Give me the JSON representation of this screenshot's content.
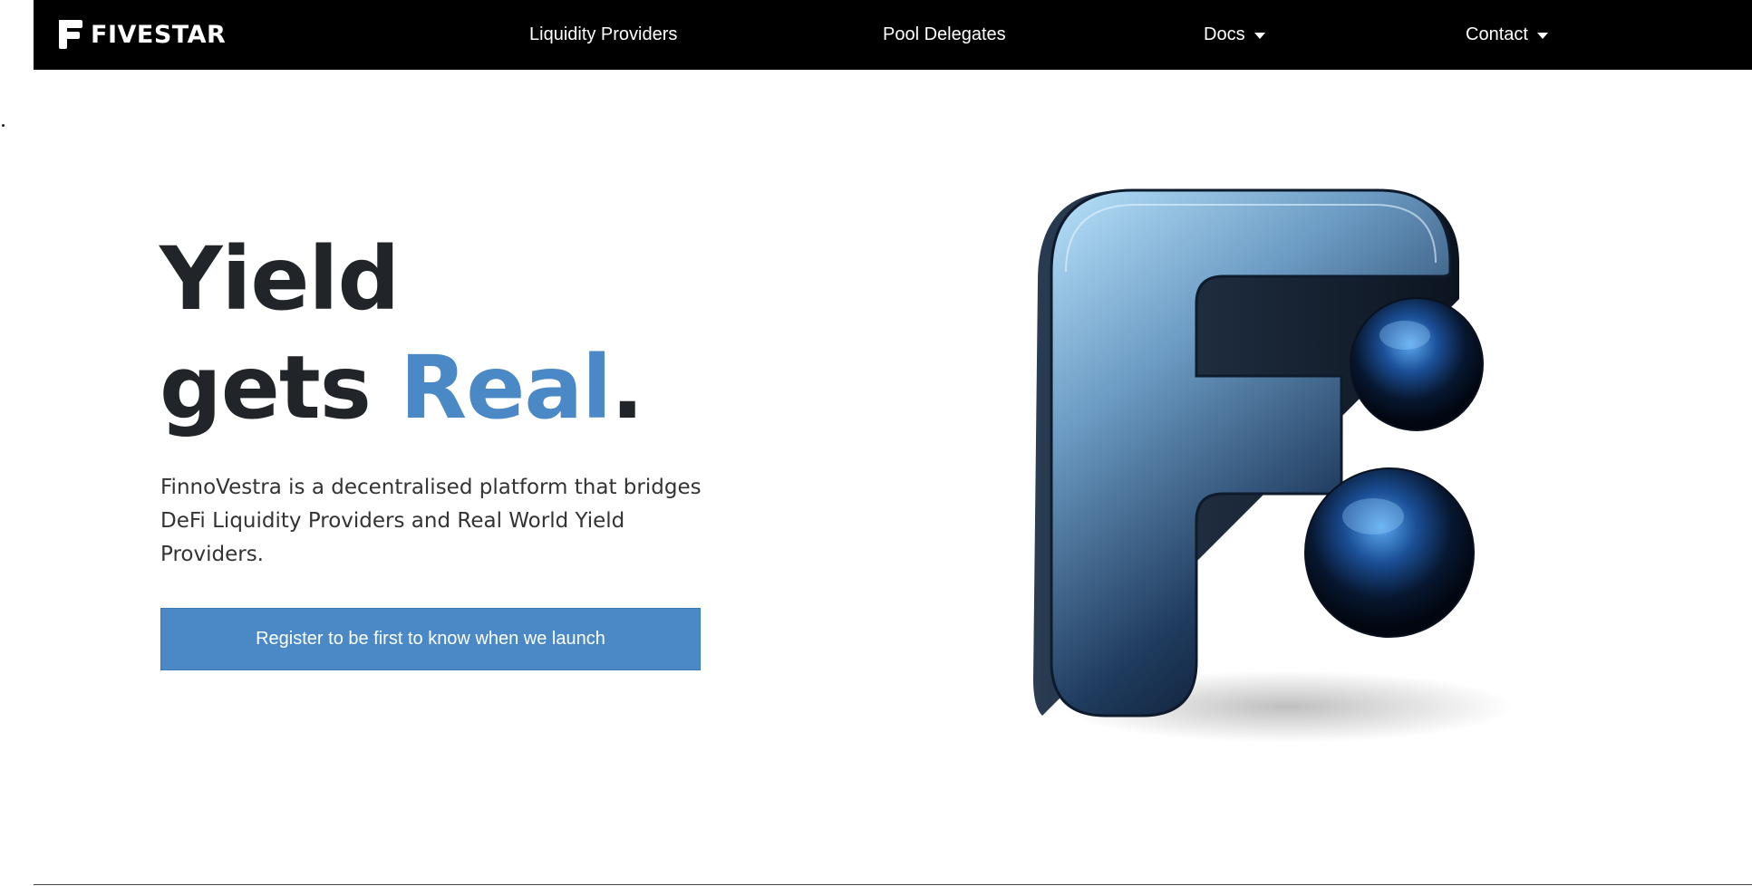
{
  "brand": {
    "name": "FIVESTAR"
  },
  "nav": {
    "items": [
      {
        "label": "Liquidity Providers",
        "dropdown": false
      },
      {
        "label": "Pool Delegates",
        "dropdown": false
      },
      {
        "label": "Docs",
        "dropdown": true
      },
      {
        "label": "Contact",
        "dropdown": true
      }
    ]
  },
  "hero": {
    "title_line1": "Yield",
    "title_line2_word": "gets",
    "title_line2_accent": "Real",
    "title_line2_period": ".",
    "description": "FinnoVestra is a decentralised platform that bridges DeFi Liquidity Providers and Real World Yield Providers.",
    "cta_label": "Register to be first to know when we launch",
    "logo_icon": "fivestar-3d-logo-icon"
  },
  "colors": {
    "navbar_bg": "#000000",
    "accent": "#4a89c5",
    "heading": "#212529",
    "body_text": "#333333"
  }
}
